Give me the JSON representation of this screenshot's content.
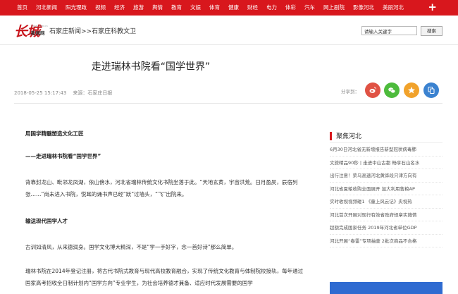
{
  "nav": {
    "items": [
      "首页",
      "河北新闻",
      "阳光理政",
      "视频",
      "经济",
      "旅游",
      "舆情",
      "教育",
      "文娱",
      "体育",
      "健康",
      "财经",
      "电力",
      "体彩",
      "汽车",
      "网上剧院",
      "影像河北",
      "美丽河北"
    ],
    "plus": "+"
  },
  "header": {
    "logo_big": "长城",
    "logo_small": "新闻网",
    "logo_tiny": "hebei.com.cn",
    "breadcrumb_1": "石家庄新闻",
    "breadcrumb_sep": ">>",
    "breadcrumb_2": "石家庄科教文卫",
    "search_placeholder": "请输入关键字",
    "search_button": "搜索"
  },
  "article": {
    "title": "走进瑞林书院看“国学世界”",
    "datetime": "2018-05-25 15:17:43",
    "source": "来源：石家庄日报",
    "share_label": "分享到：",
    "p1": "用国学精髓塑造文化工匠",
    "p2": "——走进瑞林书院看“国学世界”",
    "p3": "背靠封龙山、毗邻龙凤湖，依山傍水，河北省瑞林传统文化书院坐落于此。“天地玄黄，宇宙洪荒。日月盈昃，辰宿列张……”尚未进入书院，悦耳的诵书声已经“跃”过墙头，“飞”出院来。",
    "p4": "输送现代国学人才",
    "p5": "古训如清风，从来德润身。国学文化博大精深，不是“学一手好字，念一首好诗”那么简单。",
    "p6": "瑞林书院在2014年登记注册，将古代书院式教育与现代高校教育融合，实现了传统文化教育与体制院校接轨，每年通过国家高考招收全日制计划内“国学方向”专业学生，为社会培养德才兼备、适应时代发展需要的国学"
  },
  "sidebar": {
    "title": "聚焦河北",
    "items": [
      "6月30日河北省无新增报告新型冠状病毒肺",
      "文旅精品90秒丨走进中山古都 畅享石山名水",
      "出行注意！荣乌高速河北黄骅段只津方向有",
      "河北省夏粮收购全面展开 加大利用售粮AP",
      "实时收视视频碰1 《童上风云记》央视热",
      "河北首次开展对现行有效省政府规章实施情",
      "超额完成国家任务 2019年河北省单位GDP",
      "河北开展“春雷”专项抽查 2批次商品不合格"
    ]
  },
  "colors": {
    "brand_red": "#d8171d",
    "weibo": "#e05244",
    "wechat": "#4dbb3c",
    "qzone": "#f1a22b",
    "copy": "#3b82d0"
  },
  "icons": {
    "share": [
      "weibo-icon",
      "wechat-icon",
      "qzone-icon",
      "copy-link-icon"
    ]
  }
}
